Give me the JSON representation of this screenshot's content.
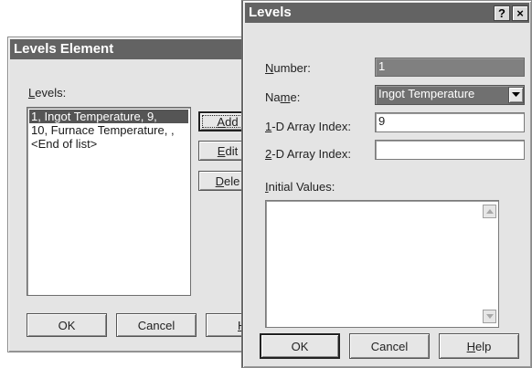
{
  "levels_element": {
    "title": "Levels Element",
    "levels_label_pre": "",
    "levels_label_key": "L",
    "levels_label_post": "evels:",
    "list": [
      "1, Ingot Temperature, 9,",
      "10, Furnace Temperature, ,",
      "<End of list>"
    ],
    "selected_index": 0,
    "add_key": "A",
    "add_rest": "dd",
    "edit_key": "E",
    "edit_rest": "dit",
    "delete_key": "D",
    "delete_rest": "ele",
    "ok_label": "OK",
    "cancel_label": "Cancel",
    "help_key": "H",
    "help_rest": ""
  },
  "levels_dialog": {
    "title": "Levels",
    "help_button_label": "?",
    "close_button_label": "×",
    "number_label_key": "N",
    "number_label_rest": "umber:",
    "number_value": "1",
    "name_label_pre": "Na",
    "name_label_key": "m",
    "name_label_post": "e:",
    "name_value": "Ingot Temperature",
    "array1d_label_key": "1",
    "array1d_label_rest": "-D Array Index:",
    "array1d_value": "9",
    "array2d_label_key": "2",
    "array2d_label_rest": "-D Array Index:",
    "array2d_value": "",
    "initial_label_key": "I",
    "initial_label_rest": "nitial Values:",
    "initial_values": "",
    "ok_label": "OK",
    "cancel_label": "Cancel",
    "help_key": "H",
    "help_rest": "elp"
  },
  "colors": {
    "titlebar": "#636363",
    "dialog_bg": "#e4e4e4",
    "selection": "#555555",
    "disabled_field": "#808080"
  }
}
